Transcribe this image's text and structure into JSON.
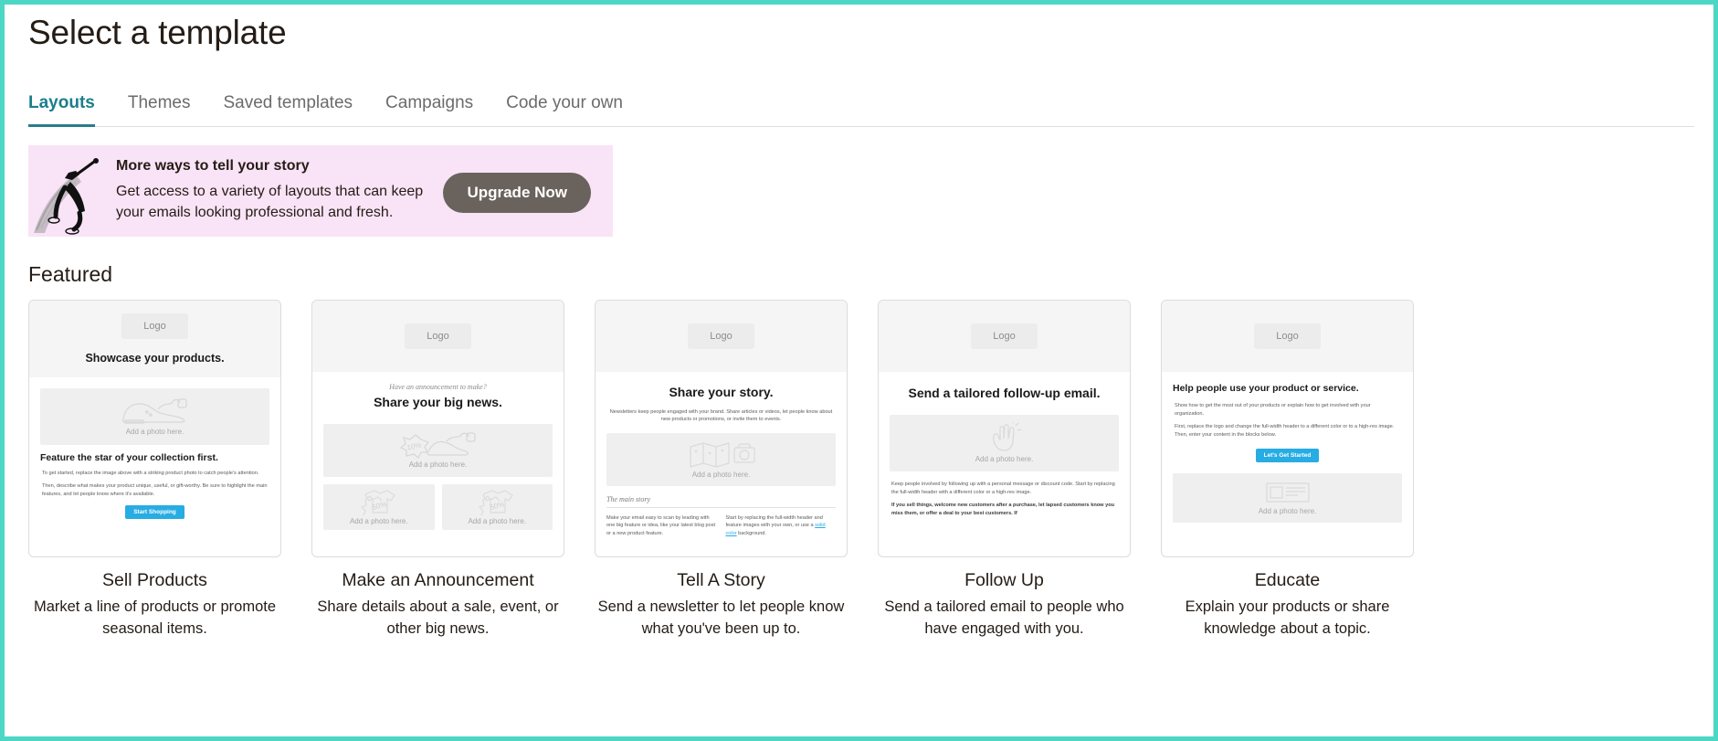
{
  "header": {
    "title": "Select a template"
  },
  "tabs": [
    {
      "label": "Layouts",
      "active": true
    },
    {
      "label": "Themes",
      "active": false
    },
    {
      "label": "Saved templates",
      "active": false
    },
    {
      "label": "Campaigns",
      "active": false
    },
    {
      "label": "Code your own",
      "active": false
    }
  ],
  "promo": {
    "title": "More ways to tell your story",
    "description": "Get access to a variety of layouts that can keep your emails looking professional and fresh.",
    "button_label": "Upgrade Now",
    "background_color": "#f9e3f6",
    "button_color": "#6a625c",
    "illustration": "caped-person-climbing-illustration"
  },
  "featured": {
    "section_title": "Featured",
    "cards": [
      {
        "label": "Sell Products",
        "description": "Market a line of products or promote seasonal items.",
        "preview": {
          "logo": "Logo",
          "headline": "Showcase your products.",
          "photo_caption": "Add a photo here.",
          "photo_icon": "shoe-icon",
          "body_heading": "Feature the star of your collection first.",
          "body_p1": "To get started, replace the image above with a striking product photo to catch people's attention.",
          "body_p2": "Then, describe what makes your product unique, useful, or gift-worthy. Be sure to highlight the main features, and let people know where it's available.",
          "cta": "Start Shopping",
          "cta_color": "#27ace3"
        }
      },
      {
        "label": "Make an Announcement",
        "description": "Share details about a sale, event, or other big news.",
        "preview": {
          "logo": "Logo",
          "eyebrow": "Have an announcement to make?",
          "headline": "Share your big news.",
          "photo_caption": "Add a photo here.",
          "photo_icon": "shoe-sale-icon",
          "photo_caption_2": "Add a photo here.",
          "photo_caption_3": "Add a photo here.",
          "photo_icon_2": "shirt-50-percent-icon",
          "photo_icon_3": "shirt-50-percent-icon"
        }
      },
      {
        "label": "Tell A Story",
        "description": "Send a newsletter to let people know what you've been up to.",
        "preview": {
          "logo": "Logo",
          "headline": "Share your story.",
          "body_p1": "Newsletters keep people engaged with your brand. Share articles or videos, let people know about new products or promotions, or invite them to events.",
          "photo_caption": "Add a photo here.",
          "photo_icon": "map-camera-icon",
          "section_label": "The main story",
          "col1": "Make your email easy to scan by leading with one big feature or idea, like your latest blog post or a new product feature.",
          "col2_pre": "Start by replacing the full-width header and feature images with your own, or use a ",
          "col2_link": "solid color",
          "col2_post": " background."
        }
      },
      {
        "label": "Follow Up",
        "description": "Send a tailored email to people who have engaged with you.",
        "preview": {
          "logo": "Logo",
          "headline": "Send a tailored follow-up email.",
          "photo_caption": "Add a photo here.",
          "photo_icon": "waving-hand-icon",
          "body_p1": "Keep people involved by following up with a personal message or discount code. Start by replacing the full-width header with a different color or a high-res image.",
          "body_p2": "If you sell things, welcome new customers after a purchase, let lapsed customers know you miss them, or offer a deal to your best customers. If"
        }
      },
      {
        "label": "Educate",
        "description": "Explain your products or share knowledge about a topic.",
        "preview": {
          "logo": "Logo",
          "headline": "Help people use your product or service.",
          "body_p1": "Show how to get the most out of your products or explain how to get involved with your organization.",
          "body_p2": "First, replace the logo and change the full-width header to a different color or to a high-res image. Then, enter your content in the blocks below.",
          "cta": "Let's Get Started",
          "cta_color": "#27ace3",
          "photo_caption": "Add a photo here.",
          "photo_icon": "layout-grid-icon"
        }
      }
    ]
  },
  "theme": {
    "accent": "#4cd7c4",
    "tab_active": "#1b7e8c"
  }
}
